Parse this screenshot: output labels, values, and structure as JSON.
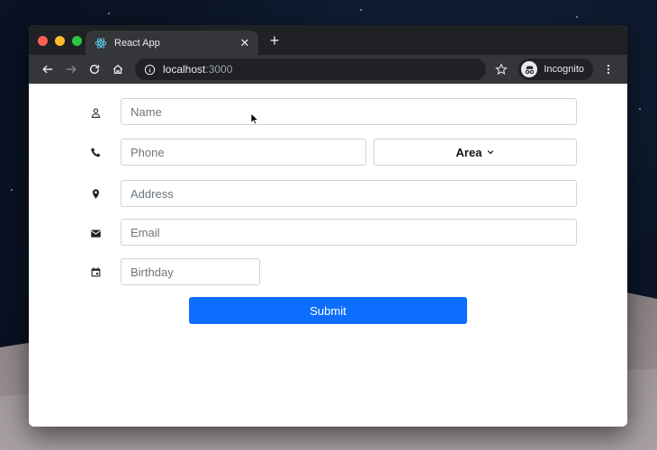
{
  "browser": {
    "tab_title": "React App",
    "url_host": "localhost",
    "url_port": ":3000",
    "profile_label": "Incognito"
  },
  "form": {
    "name": {
      "placeholder": "Name",
      "icon": "person-icon"
    },
    "phone": {
      "placeholder": "Phone",
      "icon": "phone-icon"
    },
    "area": {
      "label": "Area",
      "icon": "chevron-down-icon"
    },
    "address": {
      "placeholder": "Address",
      "icon": "location-pin-icon"
    },
    "email": {
      "placeholder": "Email",
      "icon": "mail-icon"
    },
    "birthday": {
      "placeholder": "Birthday",
      "icon": "calendar-icon"
    },
    "submit_label": "Submit"
  },
  "colors": {
    "primary": "#0d6efd",
    "chrome_dark": "#202124",
    "chrome_mid": "#35363a"
  }
}
